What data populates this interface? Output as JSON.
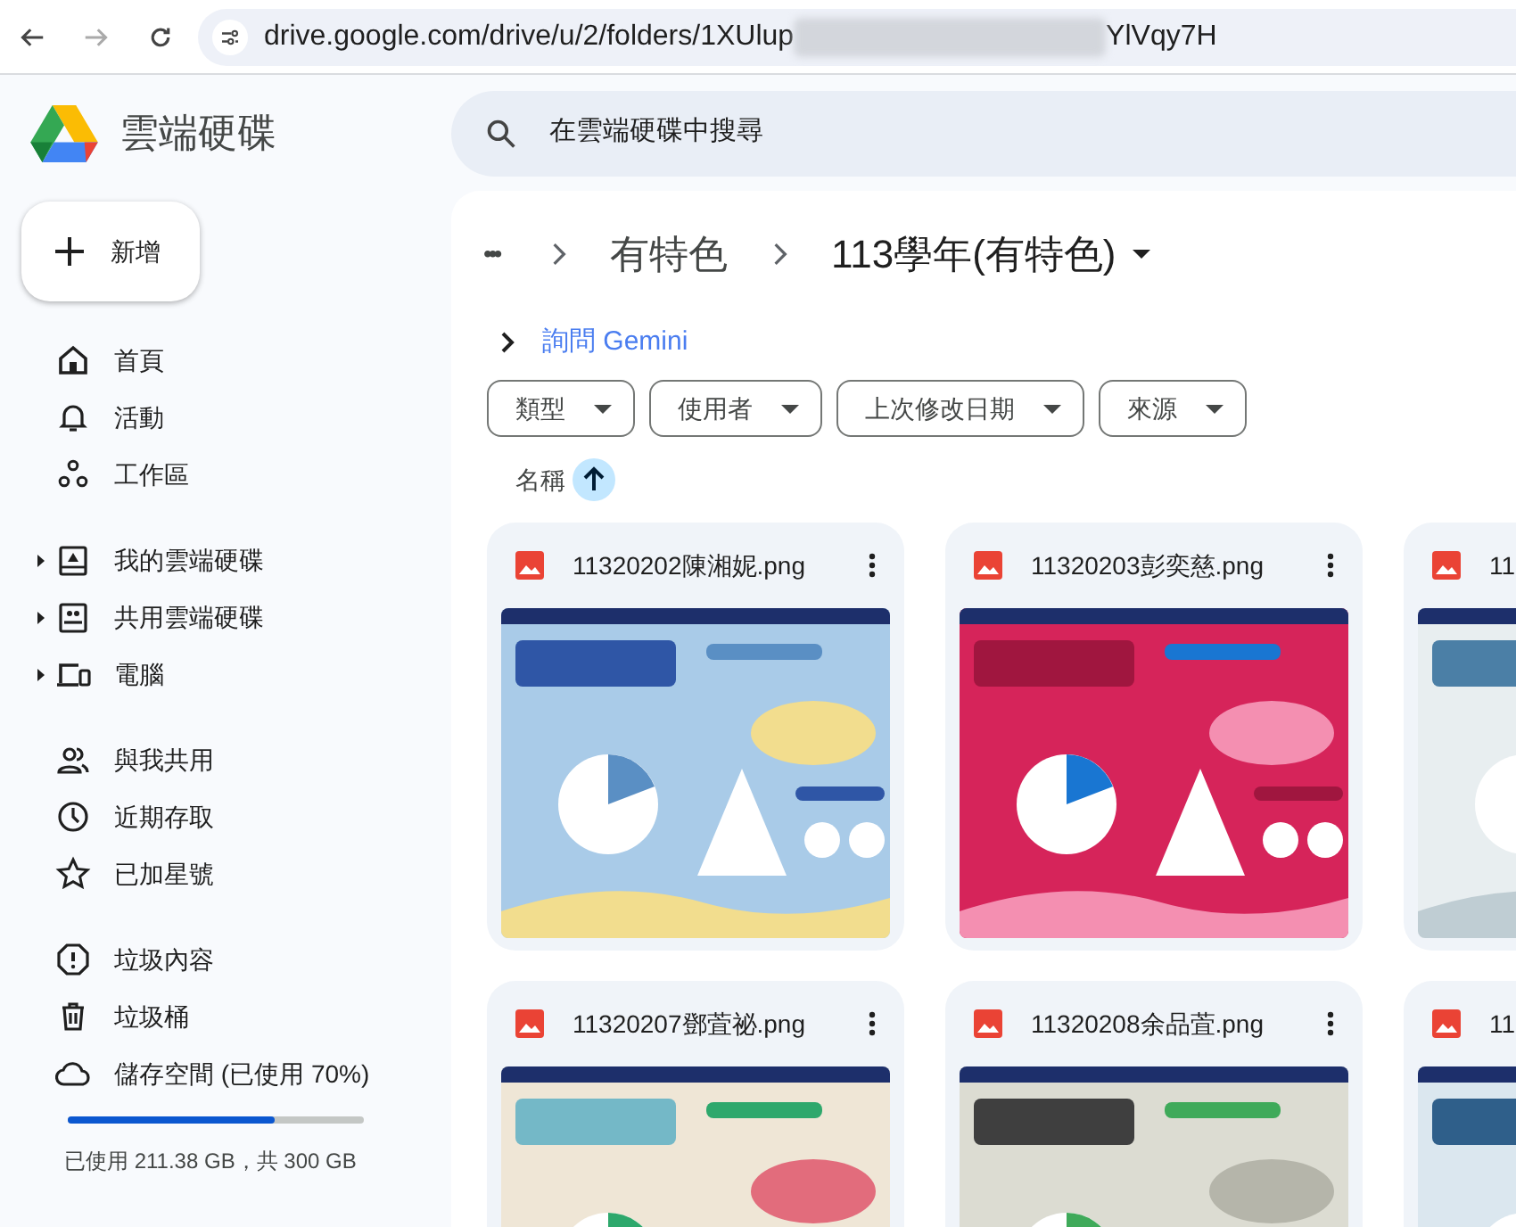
{
  "browser": {
    "url_start": "drive.google.com/drive/u/2/folders/1XUlup",
    "url_end": "YlVqy7H"
  },
  "app": {
    "name": "雲端硬碟"
  },
  "search": {
    "placeholder": "在雲端硬碟中搜尋"
  },
  "new_button": {
    "label": "新增"
  },
  "sidebar": {
    "groups": [
      [
        {
          "label": "首頁",
          "expandable": false
        },
        {
          "label": "活動",
          "expandable": false
        },
        {
          "label": "工作區",
          "expandable": false
        }
      ],
      [
        {
          "label": "我的雲端硬碟",
          "expandable": true
        },
        {
          "label": "共用雲端硬碟",
          "expandable": true
        },
        {
          "label": "電腦",
          "expandable": true
        }
      ],
      [
        {
          "label": "與我共用",
          "expandable": false
        },
        {
          "label": "近期存取",
          "expandable": false
        },
        {
          "label": "已加星號",
          "expandable": false
        }
      ],
      [
        {
          "label": "垃圾內容",
          "expandable": false
        },
        {
          "label": "垃圾桶",
          "expandable": false
        },
        {
          "label": "儲存空間 (已使用 70%)",
          "expandable": false
        }
      ]
    ]
  },
  "storage": {
    "level": 0.7,
    "text": "已使用 211.38 GB，共 300 GB"
  },
  "breadcrumb": {
    "overflow": "•••",
    "items": [
      "有特色",
      "113學年(有特色)"
    ]
  },
  "gemini": {
    "label": "詢問 Gemini"
  },
  "filters": [
    "類型",
    "使用者",
    "上次修改日期",
    "來源"
  ],
  "sort": {
    "label": "名稱"
  },
  "files": [
    {
      "name": "11320202陳湘妮.png"
    },
    {
      "name": "11320203彭奕慈.png"
    },
    {
      "name": "11"
    },
    {
      "name": "11320207鄧萓祕.png"
    },
    {
      "name": "11320208余品萓.png"
    },
    {
      "name": "11"
    }
  ]
}
